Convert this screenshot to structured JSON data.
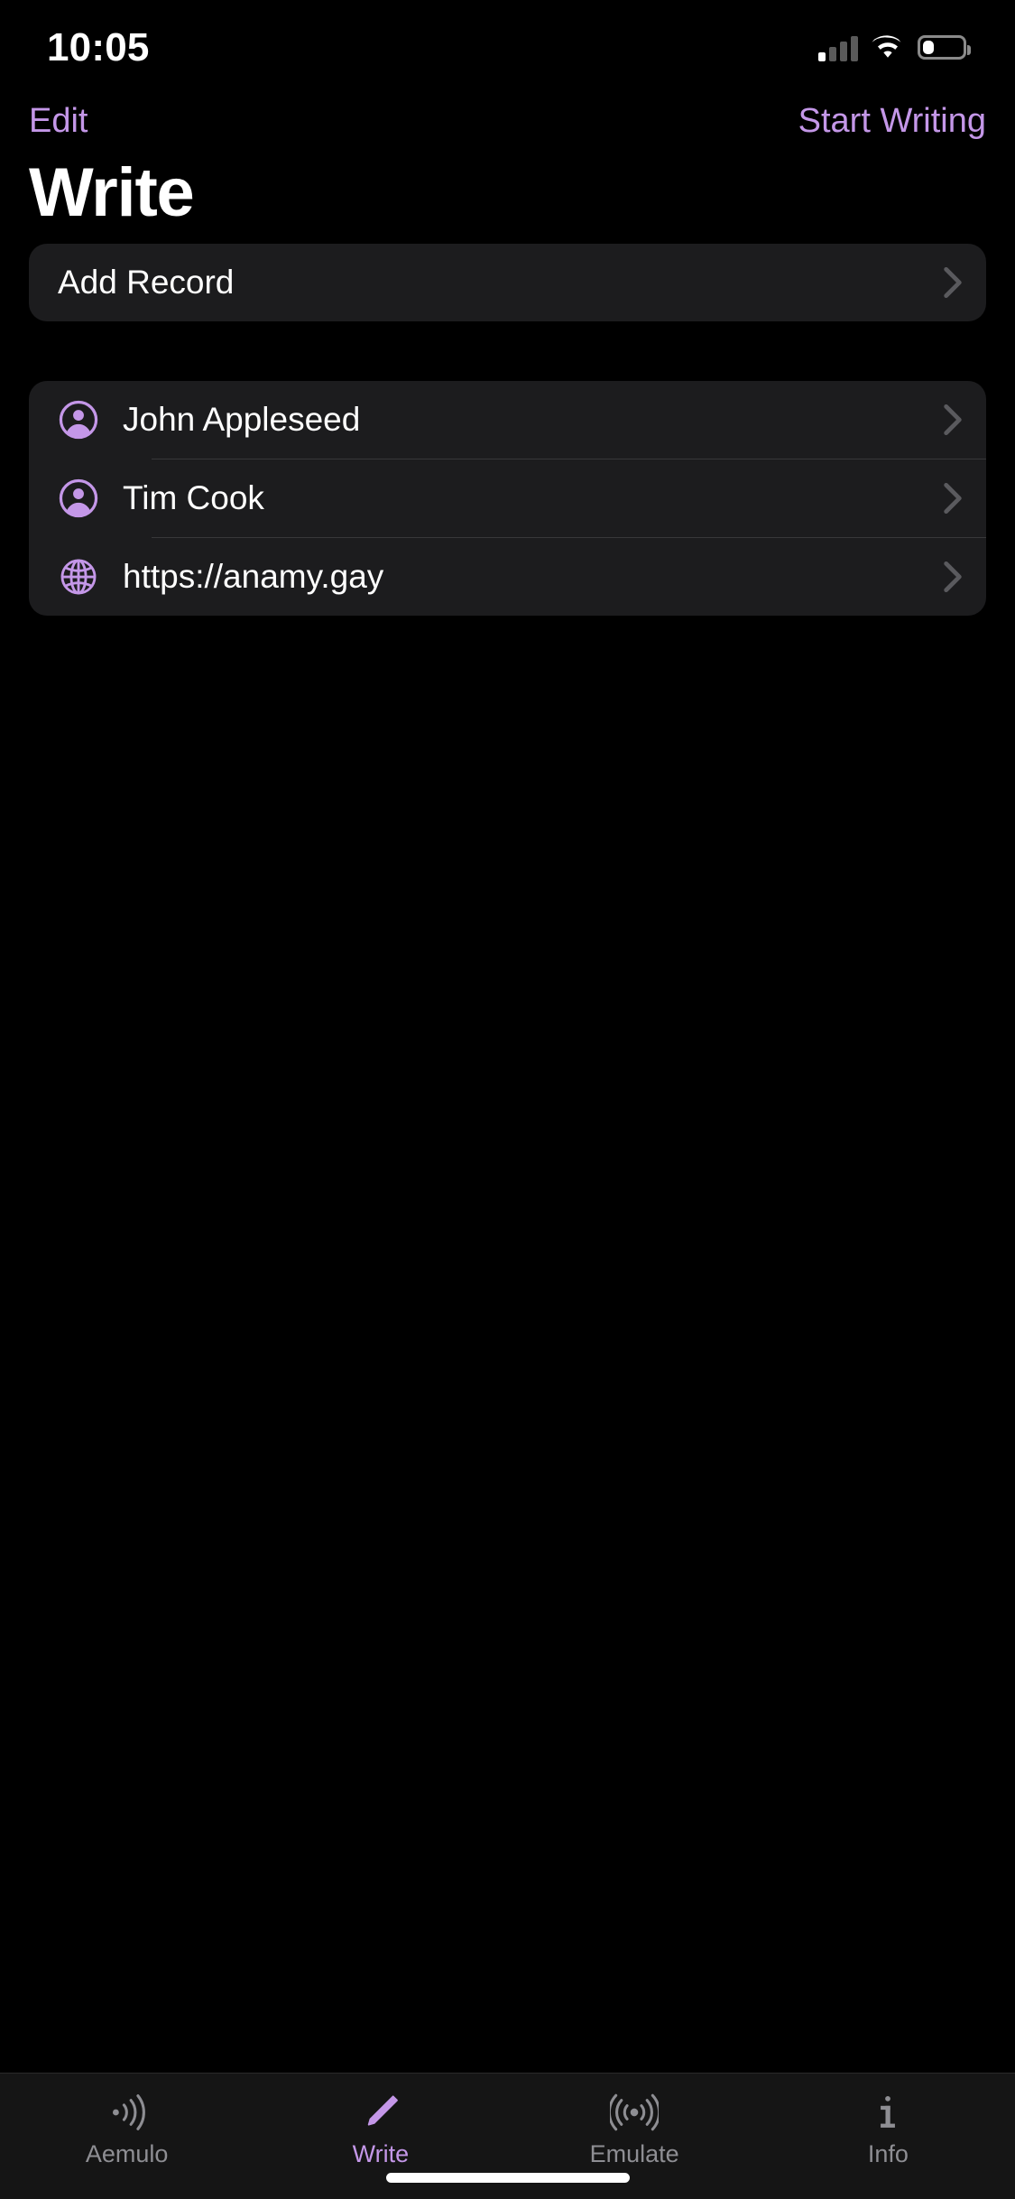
{
  "status_bar": {
    "time": "10:05",
    "cellular_bars_filled": 1,
    "cellular_bars_total": 4,
    "wifi_icon": "wifi-icon",
    "battery_icon": "battery-icon",
    "battery_level_percent": 28
  },
  "nav_bar": {
    "left_button": "Edit",
    "right_button": "Start Writing",
    "tint_color": "#C497E8"
  },
  "page_title": "Write",
  "sections": [
    {
      "name": "actions",
      "rows": [
        {
          "label": "Add Record",
          "icon": "none",
          "accessory": "chevron-right-icon"
        }
      ]
    },
    {
      "name": "records",
      "rows": [
        {
          "label": "John Appleseed",
          "icon": "person-circle-icon",
          "accessory": "chevron-right-icon"
        },
        {
          "label": "Tim Cook",
          "icon": "person-circle-icon",
          "accessory": "chevron-right-icon"
        },
        {
          "label": "https://anamy.gay",
          "icon": "globe-icon",
          "accessory": "chevron-right-icon"
        }
      ]
    }
  ],
  "tab_bar": {
    "active_index": 1,
    "active_color": "#C497E8",
    "inactive_color": "#8E8E93",
    "tabs": [
      {
        "label": "Aemulo",
        "icon": "nfc-wave-icon"
      },
      {
        "label": "Write",
        "icon": "pencil-icon"
      },
      {
        "label": "Emulate",
        "icon": "radiowaves-left-right-icon"
      },
      {
        "label": "Info",
        "icon": "info-icon"
      }
    ]
  },
  "colors": {
    "background": "#000000",
    "card": "#1C1C1E",
    "separator": "#38383A",
    "accent": "#C497E8",
    "text_primary": "#FFFFFF",
    "text_secondary": "#8E8E93"
  }
}
